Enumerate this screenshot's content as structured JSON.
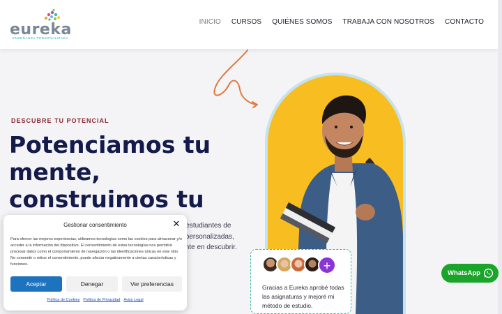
{
  "header": {
    "logo_text": "eureka",
    "logo_tagline": "ENSEÑANZA PERSONALIZADA",
    "nav": [
      {
        "label": "INICIO",
        "active": true
      },
      {
        "label": "CURSOS",
        "active": false
      },
      {
        "label": "QUIÉNES SOMOS",
        "active": false
      },
      {
        "label": "TRABAJA CON NOSOTROS",
        "active": false
      },
      {
        "label": "CONTACTO",
        "active": false
      }
    ]
  },
  "hero": {
    "eyebrow": "DESCUBRE TU POTENCIAL",
    "headline": "Potenciamos tu mente, construimos tu futuro.",
    "body_lines": [
      "a estudiantes de",
      "s personalizadas,",
      "iente en descubrir."
    ]
  },
  "testimonial": {
    "text": "Gracias a Eureka aprobé todas las asignaturas y mejoré mi método de estudio.",
    "plus_icon": "plus-icon"
  },
  "whatsapp": {
    "label": "WhatsApp",
    "icon": "whatsapp-icon",
    "color": "#1aa52a"
  },
  "cookie": {
    "title": "Gestionar consentimiento",
    "description": "Para ofrecer las mejores experiencias, utilizamos tecnologías como las cookies para almacenar y/o acceder a la información del dispositivo. El consentimiento de estas tecnologías nos permitirá procesar datos como el comportamiento de navegación o las identificaciones únicas en este sitio. No consentir o retirar el consentimiento, puede afectar negativamente a ciertas características y funciones.",
    "accept_label": "Aceptar",
    "deny_label": "Denegar",
    "prefs_label": "Ver preferencias",
    "links": [
      "Política de Cookies",
      "Política de Privacidad",
      "Aviso Legal"
    ]
  },
  "colors": {
    "accent_yellow": "#f8bd21",
    "navy": "#141a4a",
    "eyebrow_red": "#8b2a35",
    "teal": "#3cb9a1",
    "accept_blue": "#1e73be",
    "purple": "#8a35d6"
  }
}
